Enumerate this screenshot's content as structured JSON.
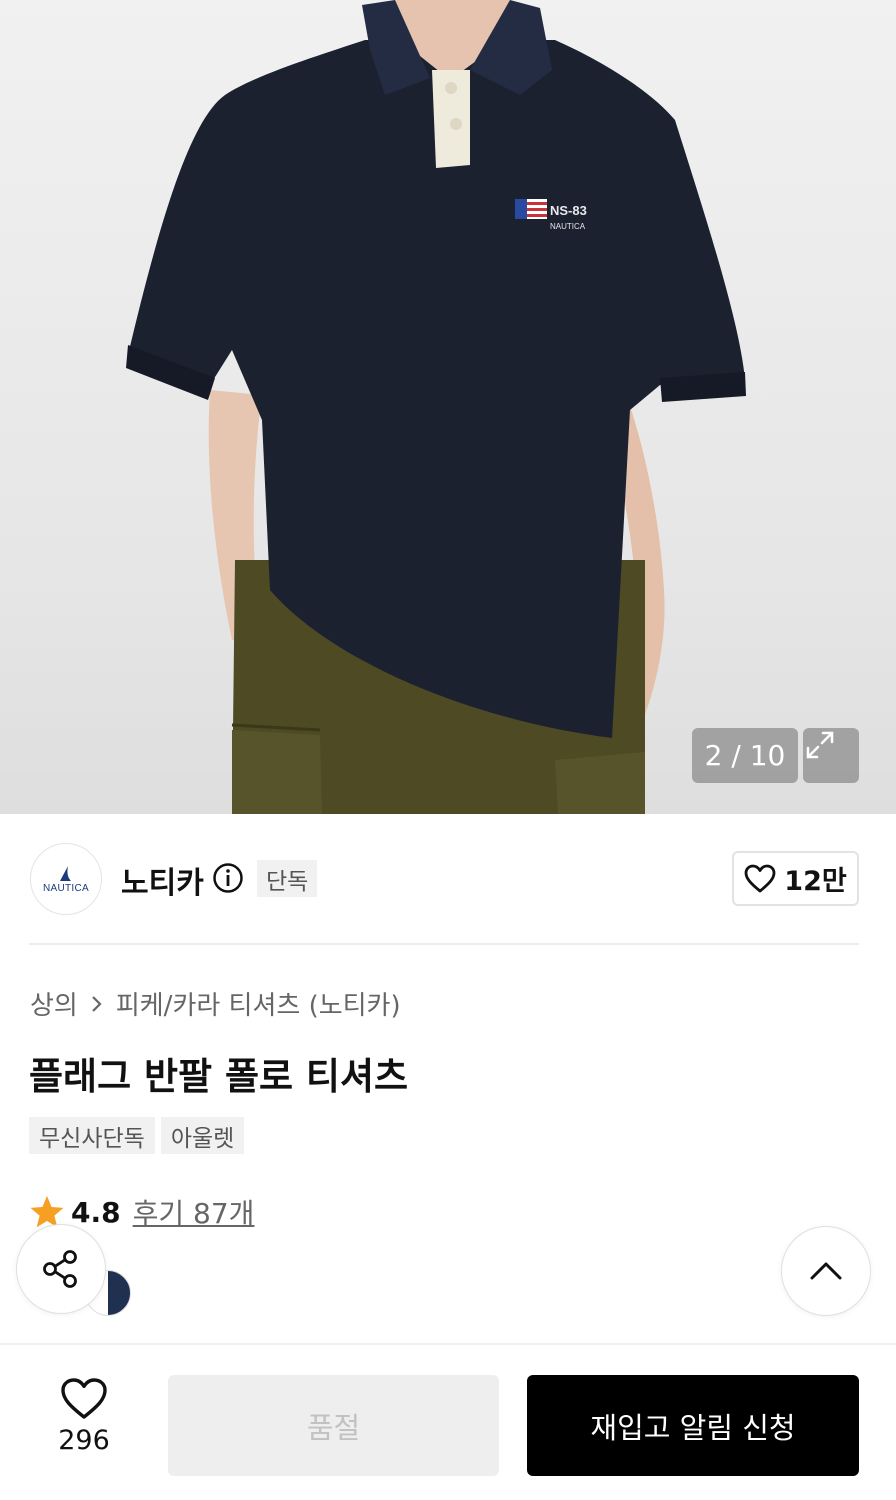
{
  "gallery": {
    "counter": "2 / 10",
    "chest_logo_line1": "NS-83",
    "chest_logo_line2": "NAUTICA"
  },
  "brand": {
    "logo_text": "NAUTICA",
    "name": "노티카",
    "exclusive_badge": "단독",
    "likes": "12만"
  },
  "product": {
    "breadcrumb": [
      "상의",
      "피케/카라 티셔츠 (노티카)"
    ],
    "title": "플래그 반팔 폴로 티셔츠",
    "tags": [
      "무신사단독",
      "아울렛"
    ],
    "rating": "4.8",
    "reviews": "후기 87개"
  },
  "bottom_bar": {
    "wish_count": "296",
    "soldout_label": "품절",
    "restock_label": "재입고 알림 신청"
  },
  "colors": {
    "star": "#f5a023",
    "shirt": "#1c2130",
    "pants": "#4d4a24"
  }
}
